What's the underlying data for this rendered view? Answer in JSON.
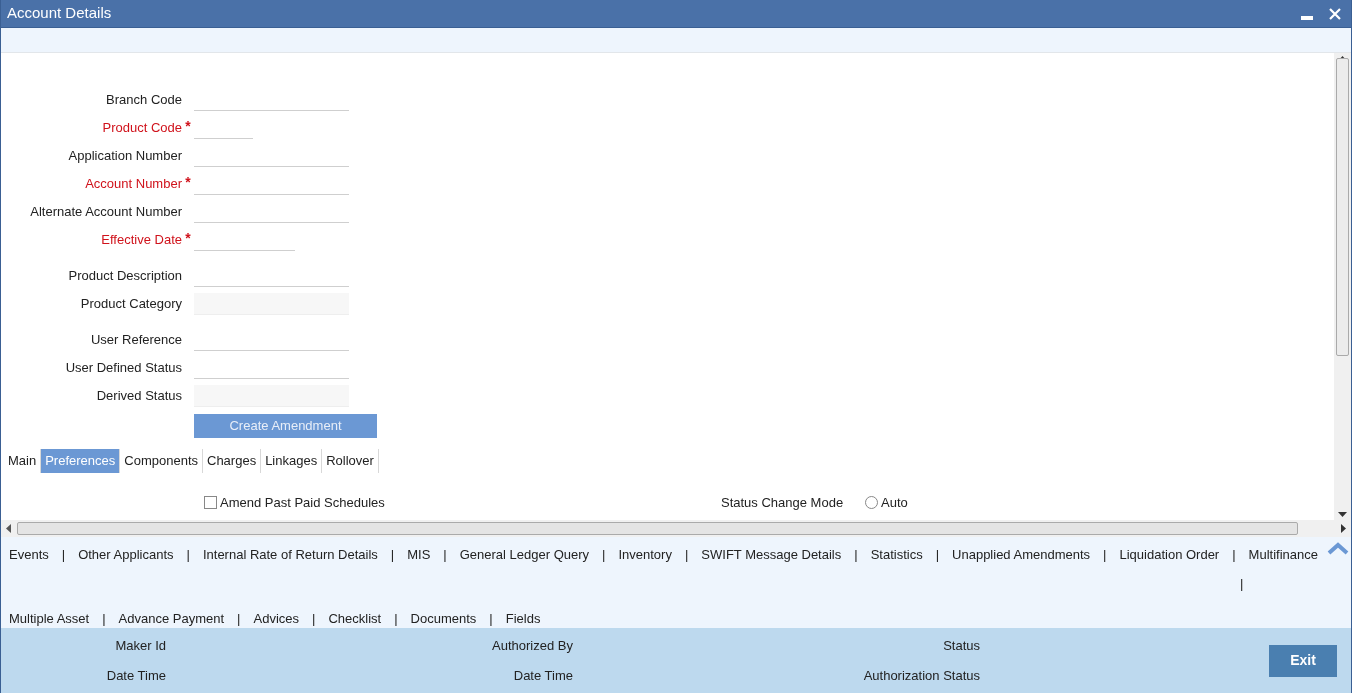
{
  "window": {
    "title": "Account Details"
  },
  "required_mark": "*",
  "field_groups": [
    [
      {
        "label": "Branch Code",
        "required": false,
        "kind": "text"
      },
      {
        "label": "Product Code",
        "required": true,
        "kind": "code"
      },
      {
        "label": "Application Number",
        "required": false,
        "kind": "text"
      },
      {
        "label": "Account Number",
        "required": true,
        "kind": "text"
      },
      {
        "label": "Alternate Account Number",
        "required": false,
        "kind": "text"
      },
      {
        "label": "Effective Date",
        "required": true,
        "kind": "date"
      }
    ],
    [
      {
        "label": "Product Description",
        "required": false,
        "kind": "text"
      },
      {
        "label": "Product Category",
        "required": false,
        "kind": "readonly"
      }
    ],
    [
      {
        "label": "User Reference",
        "required": false,
        "kind": "text"
      },
      {
        "label": "User Defined Status",
        "required": false,
        "kind": "text"
      },
      {
        "label": "Derived Status",
        "required": false,
        "kind": "readonly"
      }
    ]
  ],
  "action_button": {
    "label": "Create Amendment"
  },
  "tabs": [
    {
      "label": "Main",
      "selected": false
    },
    {
      "label": "Preferences",
      "selected": true
    },
    {
      "label": "Components",
      "selected": false
    },
    {
      "label": "Charges",
      "selected": false
    },
    {
      "label": "Linkages",
      "selected": false
    },
    {
      "label": "Rollover",
      "selected": false
    }
  ],
  "preferences": {
    "checkbox": {
      "label": "Amend Past Paid Schedules",
      "checked": false
    },
    "status_change_mode": {
      "label": "Status Change Mode",
      "option": {
        "label": "Auto",
        "selected": false
      }
    }
  },
  "links": {
    "separator": "|",
    "row_1": [
      "Events",
      "Other Applicants",
      "Internal Rate of Return Details",
      "MIS",
      "General Ledger Query",
      "Inventory",
      "SWIFT Message Details",
      "Statistics",
      "Unapplied Amendments",
      "Liquidation Order",
      "Multifinance"
    ],
    "row_2": [
      "Multiple Asset",
      "Advance Payment",
      "Advices",
      "Checklist",
      "Documents",
      "Fields"
    ]
  },
  "footer": {
    "columns": [
      [
        "Maker Id",
        "Date Time"
      ],
      [
        "Authorized By",
        "Date Time"
      ],
      [
        "Status",
        "Authorization Status"
      ]
    ],
    "exit_button": "Exit"
  }
}
